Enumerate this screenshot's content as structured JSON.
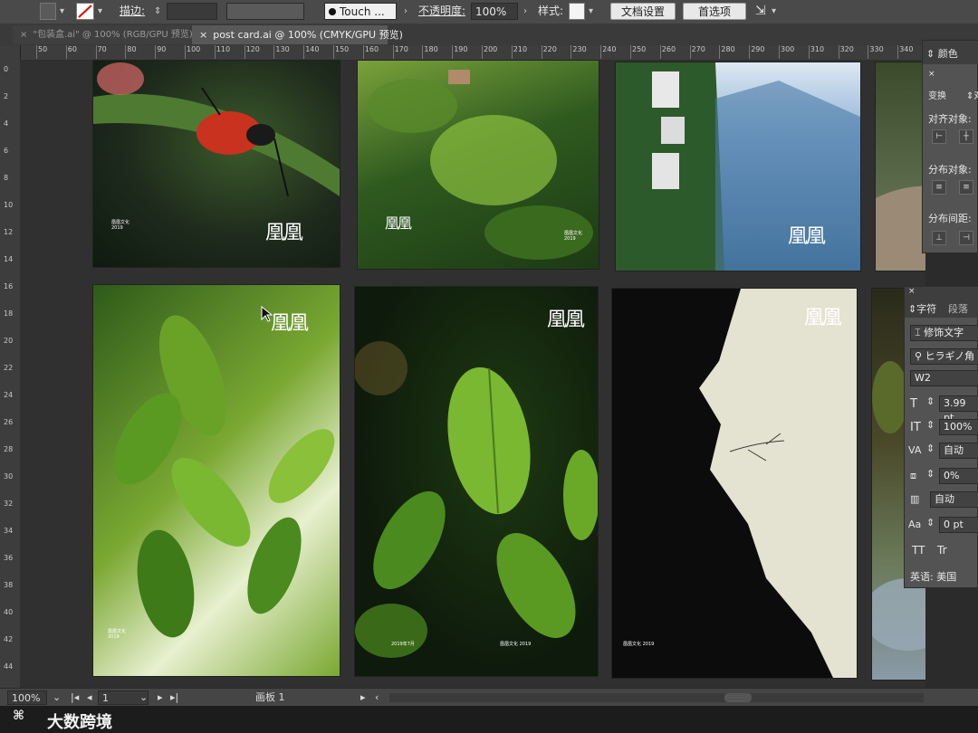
{
  "control_bar": {
    "stroke_label": "描边:",
    "touch_field": "Touch ...",
    "opacity_label": "不透明度:",
    "opacity_value": "100%",
    "style_label": "样式:",
    "doc_setup_button": "文档设置",
    "preferences_button": "首选项"
  },
  "tabs": [
    {
      "label": "\"包装盒.ai\" @ 100% (RGB/GPU 预览)",
      "active": false
    },
    {
      "label": "post card.ai @ 100% (CMYK/GPU 预览)",
      "active": true
    }
  ],
  "ruler": {
    "h_ticks": [
      "50",
      "60",
      "70",
      "80",
      "90",
      "100",
      "110",
      "120",
      "130",
      "140",
      "150",
      "160",
      "170",
      "180",
      "190",
      "200",
      "210",
      "220",
      "230",
      "240",
      "250",
      "260",
      "270",
      "280",
      "290",
      "300",
      "310",
      "320",
      "330",
      "340"
    ],
    "v_ticks": [
      "0",
      "2",
      "4",
      "6",
      "8",
      "10",
      "12",
      "14",
      "16",
      "18",
      "20",
      "22",
      "24",
      "26",
      "28",
      "30",
      "32",
      "34",
      "36",
      "38",
      "40",
      "42",
      "44"
    ]
  },
  "cards": [
    {
      "name": "card-beetle",
      "logo": "凰凰",
      "colors": [
        "#1e2a1c",
        "#3c5a2a",
        "#0f1a10"
      ]
    },
    {
      "name": "card-moss-forest",
      "logo": "凰凰",
      "colors": [
        "#2f5a1f",
        "#7aa23a",
        "#1c3a14"
      ]
    },
    {
      "name": "card-mountain-village",
      "logo": "凰凰",
      "colors": [
        "#8fb3d6",
        "#3b6a8f",
        "#dde8f2"
      ]
    },
    {
      "name": "card-rock-partial",
      "logo": "",
      "colors": [
        "#5a6a4a",
        "#8a7a6a",
        "#3a4a2a"
      ]
    },
    {
      "name": "card-tea-leaves-light",
      "logo": "凰凰",
      "colors": [
        "#e8f0d0",
        "#7aa832",
        "#2e5a1a"
      ]
    },
    {
      "name": "card-tea-leaf-dark",
      "logo": "凰凰",
      "colors": [
        "#0e1a0c",
        "#6ea82a",
        "#1e3a12"
      ]
    },
    {
      "name": "card-cliff-silhouette",
      "logo": "凰凰",
      "colors": [
        "#d8dcc8",
        "#0a0a0a",
        "#e4e2d0"
      ]
    },
    {
      "name": "card-stream-partial",
      "logo": "",
      "colors": [
        "#2a2a1a",
        "#6a7a5a",
        "#8a9aa8"
      ]
    }
  ],
  "card_texts": {
    "tiny_caption": "凰凰文化 2019",
    "stamp": "2019年7月"
  },
  "panel_top": {
    "tab_color": "颜色",
    "tab_transform": "变换",
    "tab_align": "对",
    "align_objects": "对齐对象:",
    "distribute_objects": "分布对象:",
    "distribute_spacing": "分布间距:"
  },
  "panel_char": {
    "tab_character": "字符",
    "tab_paragraph": "段落",
    "touch_type": "修饰文字",
    "font_family": "ヒラギノ角",
    "font_style": "W2",
    "font_size": "3.99 pt",
    "vertical_scale": "100%",
    "kerning": "自动",
    "tracking": "0%",
    "leading": "自动",
    "baseline": "0 pt",
    "tt_label": "TT",
    "tr_label": "Tr",
    "language": "英语: 美国"
  },
  "status_bar": {
    "zoom": "100%",
    "artboard_num": "1",
    "artboard_label": "画板 1"
  },
  "watermark": "大数跨境"
}
